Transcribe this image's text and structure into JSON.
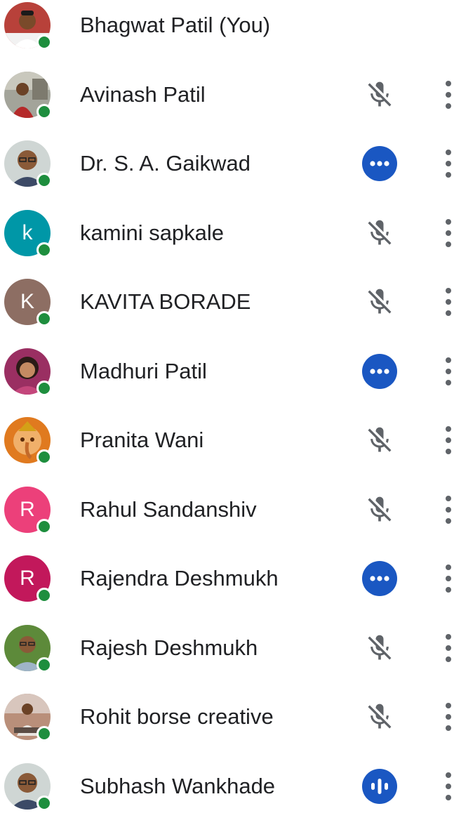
{
  "participants": [
    {
      "name": "Bhagwat Patil (You)",
      "avatar": {
        "type": "photo",
        "icon": "person-photo-man-white-shirt"
      },
      "status": "none",
      "show_menu": false,
      "online": true
    },
    {
      "name": "Avinash Patil",
      "avatar": {
        "type": "photo",
        "icon": "person-photo-man-outdoor"
      },
      "status": "muted",
      "show_menu": true,
      "online": true
    },
    {
      "name": "Dr. S. A. Gaikwad",
      "avatar": {
        "type": "photo",
        "icon": "person-photo-man-glasses"
      },
      "status": "more",
      "show_menu": true,
      "online": true
    },
    {
      "name": "kamini sapkale",
      "avatar": {
        "type": "initial",
        "letter": "k",
        "color": "#0097a7"
      },
      "status": "muted",
      "show_menu": true,
      "online": true
    },
    {
      "name": "KAVITA BORADE",
      "avatar": {
        "type": "initial",
        "letter": "K",
        "color": "#8d6e63"
      },
      "status": "muted",
      "show_menu": true,
      "online": true
    },
    {
      "name": "Madhuri Patil",
      "avatar": {
        "type": "photo",
        "icon": "person-photo-woman"
      },
      "status": "more",
      "show_menu": true,
      "online": true
    },
    {
      "name": "Pranita Wani",
      "avatar": {
        "type": "photo",
        "icon": "ganesha-image"
      },
      "status": "muted",
      "show_menu": true,
      "online": true
    },
    {
      "name": "Rahul Sandanshiv",
      "avatar": {
        "type": "initial",
        "letter": "R",
        "color": "#ec407a"
      },
      "status": "muted",
      "show_menu": true,
      "online": true
    },
    {
      "name": "Rajendra Deshmukh",
      "avatar": {
        "type": "initial",
        "letter": "R",
        "color": "#c2185b"
      },
      "status": "more",
      "show_menu": true,
      "online": true
    },
    {
      "name": "Rajesh Deshmukh",
      "avatar": {
        "type": "photo",
        "icon": "person-photo-man-green-background"
      },
      "status": "muted",
      "show_menu": true,
      "online": true
    },
    {
      "name": "Rohit borse creative",
      "avatar": {
        "type": "photo",
        "icon": "person-photo-man-sitting"
      },
      "status": "muted",
      "show_menu": true,
      "online": true
    },
    {
      "name": "Subhash Wankhade",
      "avatar": {
        "type": "photo",
        "icon": "person-photo-man-glasses"
      },
      "status": "speaking",
      "show_menu": true,
      "online": true
    }
  ],
  "colors": {
    "text": "#202124",
    "presence": "#1e8e3e",
    "accent": "#1a57c2",
    "icon_gray": "#5f6368"
  }
}
